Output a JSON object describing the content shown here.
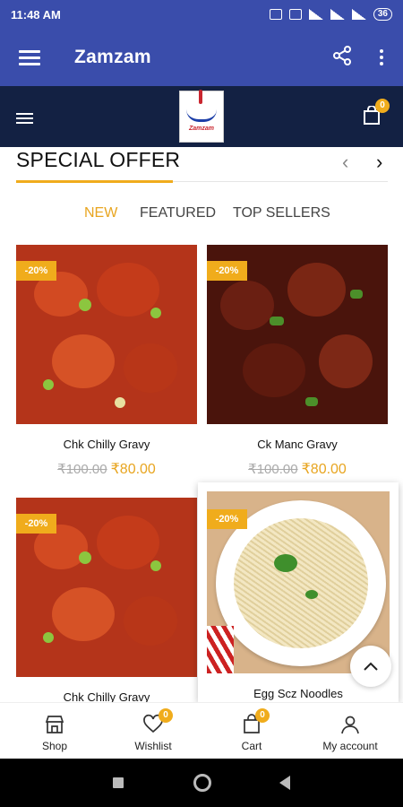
{
  "status_bar": {
    "time": "11:48 AM",
    "battery": "36"
  },
  "app_bar": {
    "title": "Zamzam"
  },
  "site_header": {
    "cart_count": "0",
    "logo_alt": "Zamzam"
  },
  "special_offer": {
    "title": "SPECIAL OFFER",
    "tabs": [
      {
        "label": "NEW",
        "active": true
      },
      {
        "label": "FEATURED",
        "active": false
      },
      {
        "label": "TOP SELLERS",
        "active": false
      }
    ]
  },
  "products": [
    {
      "name": "Chk Chilly Gravy",
      "discount": "-20%",
      "old_price": "₹100.00",
      "price": "₹80.00"
    },
    {
      "name": "Ck Manc Gravy",
      "discount": "-20%",
      "old_price": "₹100.00",
      "price": "₹80.00"
    },
    {
      "name": "Chk Chilly Gravy",
      "discount": "-20%",
      "old_price": "",
      "price": ""
    },
    {
      "name": "Egg Scz Noodles",
      "discount": "-20%",
      "old_price": "",
      "price": ""
    }
  ],
  "bottom_nav": {
    "items": [
      {
        "label": "Shop",
        "icon": "shop-icon"
      },
      {
        "label": "Wishlist",
        "icon": "heart-icon",
        "badge": "0"
      },
      {
        "label": "Cart",
        "icon": "bag-icon",
        "badge": "0"
      },
      {
        "label": "My account",
        "icon": "user-icon"
      }
    ]
  },
  "colors": {
    "primary": "#3a4dab",
    "header_dark": "#132143",
    "accent": "#f0ac1c"
  }
}
